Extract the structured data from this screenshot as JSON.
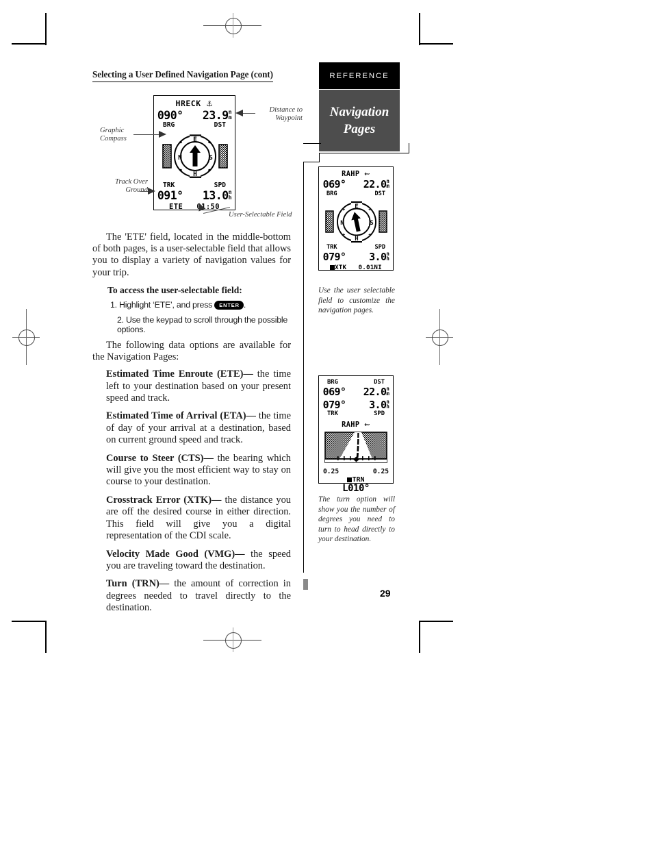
{
  "document": {
    "page_number": "29",
    "section_tab": "REFERENCE",
    "chapter_tab_line1": "Navigation",
    "chapter_tab_line2": "Pages"
  },
  "main": {
    "section_title": "Selecting a User Defined Navigation Page (cont)",
    "intro_paragraph": "The 'ETE' field, located in the middle-bottom of both pages, is a user-selectable field that allows you to display a variety of navigation values for your trip.",
    "procedure_heading": "To access the user-selectable field:",
    "step1_before": "1. Highlight ‘ETE’, and press",
    "step1_key": "ENTER",
    "step1_after": ".",
    "step2": "2. Use the keypad to scroll through the possible options.",
    "options_intro": "The following data options are available for the Navigation Pages:",
    "definitions": [
      {
        "term": "Estimated Time Enroute (ETE)—",
        "text": " the time left to your destination based on your present speed and track."
      },
      {
        "term": "Estimated Time of Arrival (ETA)—",
        "text": " the time of day of your arrival at a destination, based on current ground speed and track."
      },
      {
        "term": "Course to Steer (CTS)—",
        "text": " the bearing which will give you the most efficient way to stay on course to your destination."
      },
      {
        "term": "Crosstrack Error (XTK)—",
        "text": " the distance you are off the desired course in either direction.  This field will give you a digital representation of the CDI scale."
      },
      {
        "term": "Velocity Made Good (VMG)—",
        "text": " the speed you are traveling toward the destination."
      },
      {
        "term": "Turn (TRN)—",
        "text": " the amount of correction in degrees needed to travel directly to the destination."
      }
    ]
  },
  "callouts": {
    "graphic_compass": "Graphic\nCompass",
    "graphic_compass_l1": "Graphic",
    "graphic_compass_l2": "Compass",
    "track_over_ground_l1": "Track Over",
    "track_over_ground_l2": "Ground",
    "distance_to_waypoint_l1": "Distance to",
    "distance_to_waypoint_l2": "Waypoint",
    "user_selectable_field": "User-Selectable Field"
  },
  "screens": {
    "main_compass": {
      "waypoint_name": "HRECK",
      "waypoint_icon": "anchor-icon",
      "bearing": "090°",
      "distance": "23.9",
      "distance_unit_top": "n",
      "distance_unit_bot": "m",
      "label_left": "BRG",
      "label_right": "DST",
      "track": "091°",
      "speed": "13.0",
      "speed_unit_top": "n",
      "speed_unit_bot": "h",
      "label_trk": "TRK",
      "label_spd": "SPD",
      "user_field_label": "ETE",
      "user_field_value": "01:50",
      "compass_marks": [
        "E",
        "N",
        "S",
        "H"
      ]
    },
    "side_compass": {
      "waypoint_name": "RAHP",
      "waypoint_icon": "boat-ramp-icon",
      "bearing": "069°",
      "distance": "22.0",
      "distance_unit_top": "n",
      "distance_unit_bot": "m",
      "label_left": "BRG",
      "label_right": "DST",
      "track": "079°",
      "speed": "3.0",
      "speed_unit_top": "n",
      "speed_unit_bot": "h",
      "label_trk": "TRK",
      "label_spd": "SPD",
      "user_field_label": "XTK",
      "user_field_value": "0.01NI",
      "compass_marks": [
        "E",
        "N",
        "S",
        "H"
      ]
    },
    "side_highway": {
      "label_brg": "BRG",
      "label_dst": "DST",
      "bearing": "069°",
      "distance": "22.0",
      "distance_unit_top": "n",
      "distance_unit_bot": "m",
      "track": "079°",
      "speed": "3.0",
      "speed_unit_top": "n",
      "speed_unit_bot": "h",
      "label_trk": "TRK",
      "label_spd": "SPD",
      "waypoint_name": "RAHP",
      "waypoint_icon": "boat-ramp-icon",
      "cdi_left": "0.25",
      "cdi_right": "0.25",
      "user_field_label": "TRN",
      "user_field_value": "L010°"
    }
  },
  "captions": {
    "side1": "Use the user selectable field to customize the navigation pages.",
    "side2": "The turn option will show you the number of degrees you need to turn to head directly to your destination."
  },
  "colors": {
    "tab_reference_bg": "#000000",
    "tab_navigation_bg": "#4d4d4d",
    "text": "#1a1a1a",
    "caption_text": "#2b2b2b",
    "leader_line": "#555555"
  }
}
